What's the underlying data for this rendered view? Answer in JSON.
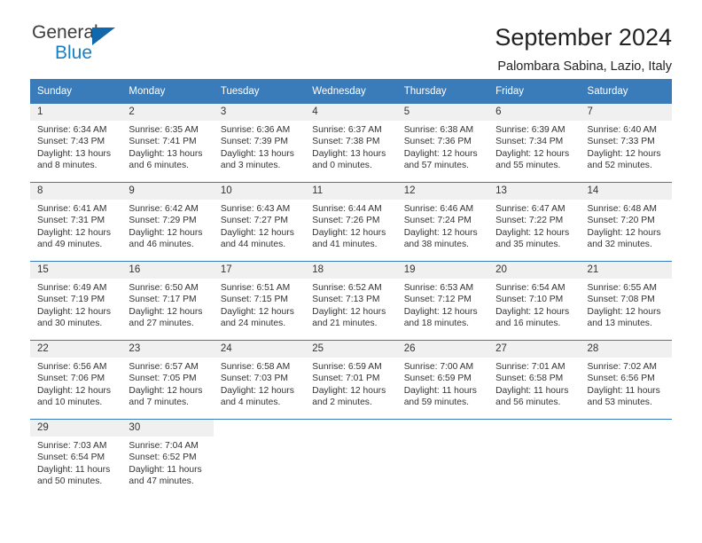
{
  "brand": {
    "name_top": "General",
    "name_bottom": "Blue",
    "triangle_icon": "triangle-icon",
    "accent_color": "#1268ad"
  },
  "header": {
    "title": "September 2024",
    "subtitle": "Palombara Sabina, Lazio, Italy"
  },
  "theme": {
    "header_blue": "#3a7cba",
    "daynum_bg": "#f0f0f0",
    "text": "#333333"
  },
  "labels": {
    "sunrise": "Sunrise:",
    "sunset": "Sunset:",
    "daylight": "Daylight:"
  },
  "weekdays": [
    "Sunday",
    "Monday",
    "Tuesday",
    "Wednesday",
    "Thursday",
    "Friday",
    "Saturday"
  ],
  "weeks": [
    [
      {
        "day": "1",
        "sunrise": "Sunrise: 6:34 AM",
        "sunset": "Sunset: 7:43 PM",
        "daylight_line1": "Daylight: 13 hours",
        "daylight_line2": "and 8 minutes."
      },
      {
        "day": "2",
        "sunrise": "Sunrise: 6:35 AM",
        "sunset": "Sunset: 7:41 PM",
        "daylight_line1": "Daylight: 13 hours",
        "daylight_line2": "and 6 minutes."
      },
      {
        "day": "3",
        "sunrise": "Sunrise: 6:36 AM",
        "sunset": "Sunset: 7:39 PM",
        "daylight_line1": "Daylight: 13 hours",
        "daylight_line2": "and 3 minutes."
      },
      {
        "day": "4",
        "sunrise": "Sunrise: 6:37 AM",
        "sunset": "Sunset: 7:38 PM",
        "daylight_line1": "Daylight: 13 hours",
        "daylight_line2": "and 0 minutes."
      },
      {
        "day": "5",
        "sunrise": "Sunrise: 6:38 AM",
        "sunset": "Sunset: 7:36 PM",
        "daylight_line1": "Daylight: 12 hours",
        "daylight_line2": "and 57 minutes."
      },
      {
        "day": "6",
        "sunrise": "Sunrise: 6:39 AM",
        "sunset": "Sunset: 7:34 PM",
        "daylight_line1": "Daylight: 12 hours",
        "daylight_line2": "and 55 minutes."
      },
      {
        "day": "7",
        "sunrise": "Sunrise: 6:40 AM",
        "sunset": "Sunset: 7:33 PM",
        "daylight_line1": "Daylight: 12 hours",
        "daylight_line2": "and 52 minutes."
      }
    ],
    [
      {
        "day": "8",
        "sunrise": "Sunrise: 6:41 AM",
        "sunset": "Sunset: 7:31 PM",
        "daylight_line1": "Daylight: 12 hours",
        "daylight_line2": "and 49 minutes."
      },
      {
        "day": "9",
        "sunrise": "Sunrise: 6:42 AM",
        "sunset": "Sunset: 7:29 PM",
        "daylight_line1": "Daylight: 12 hours",
        "daylight_line2": "and 46 minutes."
      },
      {
        "day": "10",
        "sunrise": "Sunrise: 6:43 AM",
        "sunset": "Sunset: 7:27 PM",
        "daylight_line1": "Daylight: 12 hours",
        "daylight_line2": "and 44 minutes."
      },
      {
        "day": "11",
        "sunrise": "Sunrise: 6:44 AM",
        "sunset": "Sunset: 7:26 PM",
        "daylight_line1": "Daylight: 12 hours",
        "daylight_line2": "and 41 minutes."
      },
      {
        "day": "12",
        "sunrise": "Sunrise: 6:46 AM",
        "sunset": "Sunset: 7:24 PM",
        "daylight_line1": "Daylight: 12 hours",
        "daylight_line2": "and 38 minutes."
      },
      {
        "day": "13",
        "sunrise": "Sunrise: 6:47 AM",
        "sunset": "Sunset: 7:22 PM",
        "daylight_line1": "Daylight: 12 hours",
        "daylight_line2": "and 35 minutes."
      },
      {
        "day": "14",
        "sunrise": "Sunrise: 6:48 AM",
        "sunset": "Sunset: 7:20 PM",
        "daylight_line1": "Daylight: 12 hours",
        "daylight_line2": "and 32 minutes."
      }
    ],
    [
      {
        "day": "15",
        "sunrise": "Sunrise: 6:49 AM",
        "sunset": "Sunset: 7:19 PM",
        "daylight_line1": "Daylight: 12 hours",
        "daylight_line2": "and 30 minutes."
      },
      {
        "day": "16",
        "sunrise": "Sunrise: 6:50 AM",
        "sunset": "Sunset: 7:17 PM",
        "daylight_line1": "Daylight: 12 hours",
        "daylight_line2": "and 27 minutes."
      },
      {
        "day": "17",
        "sunrise": "Sunrise: 6:51 AM",
        "sunset": "Sunset: 7:15 PM",
        "daylight_line1": "Daylight: 12 hours",
        "daylight_line2": "and 24 minutes."
      },
      {
        "day": "18",
        "sunrise": "Sunrise: 6:52 AM",
        "sunset": "Sunset: 7:13 PM",
        "daylight_line1": "Daylight: 12 hours",
        "daylight_line2": "and 21 minutes."
      },
      {
        "day": "19",
        "sunrise": "Sunrise: 6:53 AM",
        "sunset": "Sunset: 7:12 PM",
        "daylight_line1": "Daylight: 12 hours",
        "daylight_line2": "and 18 minutes."
      },
      {
        "day": "20",
        "sunrise": "Sunrise: 6:54 AM",
        "sunset": "Sunset: 7:10 PM",
        "daylight_line1": "Daylight: 12 hours",
        "daylight_line2": "and 16 minutes."
      },
      {
        "day": "21",
        "sunrise": "Sunrise: 6:55 AM",
        "sunset": "Sunset: 7:08 PM",
        "daylight_line1": "Daylight: 12 hours",
        "daylight_line2": "and 13 minutes."
      }
    ],
    [
      {
        "day": "22",
        "sunrise": "Sunrise: 6:56 AM",
        "sunset": "Sunset: 7:06 PM",
        "daylight_line1": "Daylight: 12 hours",
        "daylight_line2": "and 10 minutes."
      },
      {
        "day": "23",
        "sunrise": "Sunrise: 6:57 AM",
        "sunset": "Sunset: 7:05 PM",
        "daylight_line1": "Daylight: 12 hours",
        "daylight_line2": "and 7 minutes."
      },
      {
        "day": "24",
        "sunrise": "Sunrise: 6:58 AM",
        "sunset": "Sunset: 7:03 PM",
        "daylight_line1": "Daylight: 12 hours",
        "daylight_line2": "and 4 minutes."
      },
      {
        "day": "25",
        "sunrise": "Sunrise: 6:59 AM",
        "sunset": "Sunset: 7:01 PM",
        "daylight_line1": "Daylight: 12 hours",
        "daylight_line2": "and 2 minutes."
      },
      {
        "day": "26",
        "sunrise": "Sunrise: 7:00 AM",
        "sunset": "Sunset: 6:59 PM",
        "daylight_line1": "Daylight: 11 hours",
        "daylight_line2": "and 59 minutes."
      },
      {
        "day": "27",
        "sunrise": "Sunrise: 7:01 AM",
        "sunset": "Sunset: 6:58 PM",
        "daylight_line1": "Daylight: 11 hours",
        "daylight_line2": "and 56 minutes."
      },
      {
        "day": "28",
        "sunrise": "Sunrise: 7:02 AM",
        "sunset": "Sunset: 6:56 PM",
        "daylight_line1": "Daylight: 11 hours",
        "daylight_line2": "and 53 minutes."
      }
    ],
    [
      {
        "day": "29",
        "sunrise": "Sunrise: 7:03 AM",
        "sunset": "Sunset: 6:54 PM",
        "daylight_line1": "Daylight: 11 hours",
        "daylight_line2": "and 50 minutes."
      },
      {
        "day": "30",
        "sunrise": "Sunrise: 7:04 AM",
        "sunset": "Sunset: 6:52 PM",
        "daylight_line1": "Daylight: 11 hours",
        "daylight_line2": "and 47 minutes."
      },
      {
        "day": "",
        "sunrise": "",
        "sunset": "",
        "daylight_line1": "",
        "daylight_line2": ""
      },
      {
        "day": "",
        "sunrise": "",
        "sunset": "",
        "daylight_line1": "",
        "daylight_line2": ""
      },
      {
        "day": "",
        "sunrise": "",
        "sunset": "",
        "daylight_line1": "",
        "daylight_line2": ""
      },
      {
        "day": "",
        "sunrise": "",
        "sunset": "",
        "daylight_line1": "",
        "daylight_line2": ""
      },
      {
        "day": "",
        "sunrise": "",
        "sunset": "",
        "daylight_line1": "",
        "daylight_line2": ""
      }
    ]
  ]
}
